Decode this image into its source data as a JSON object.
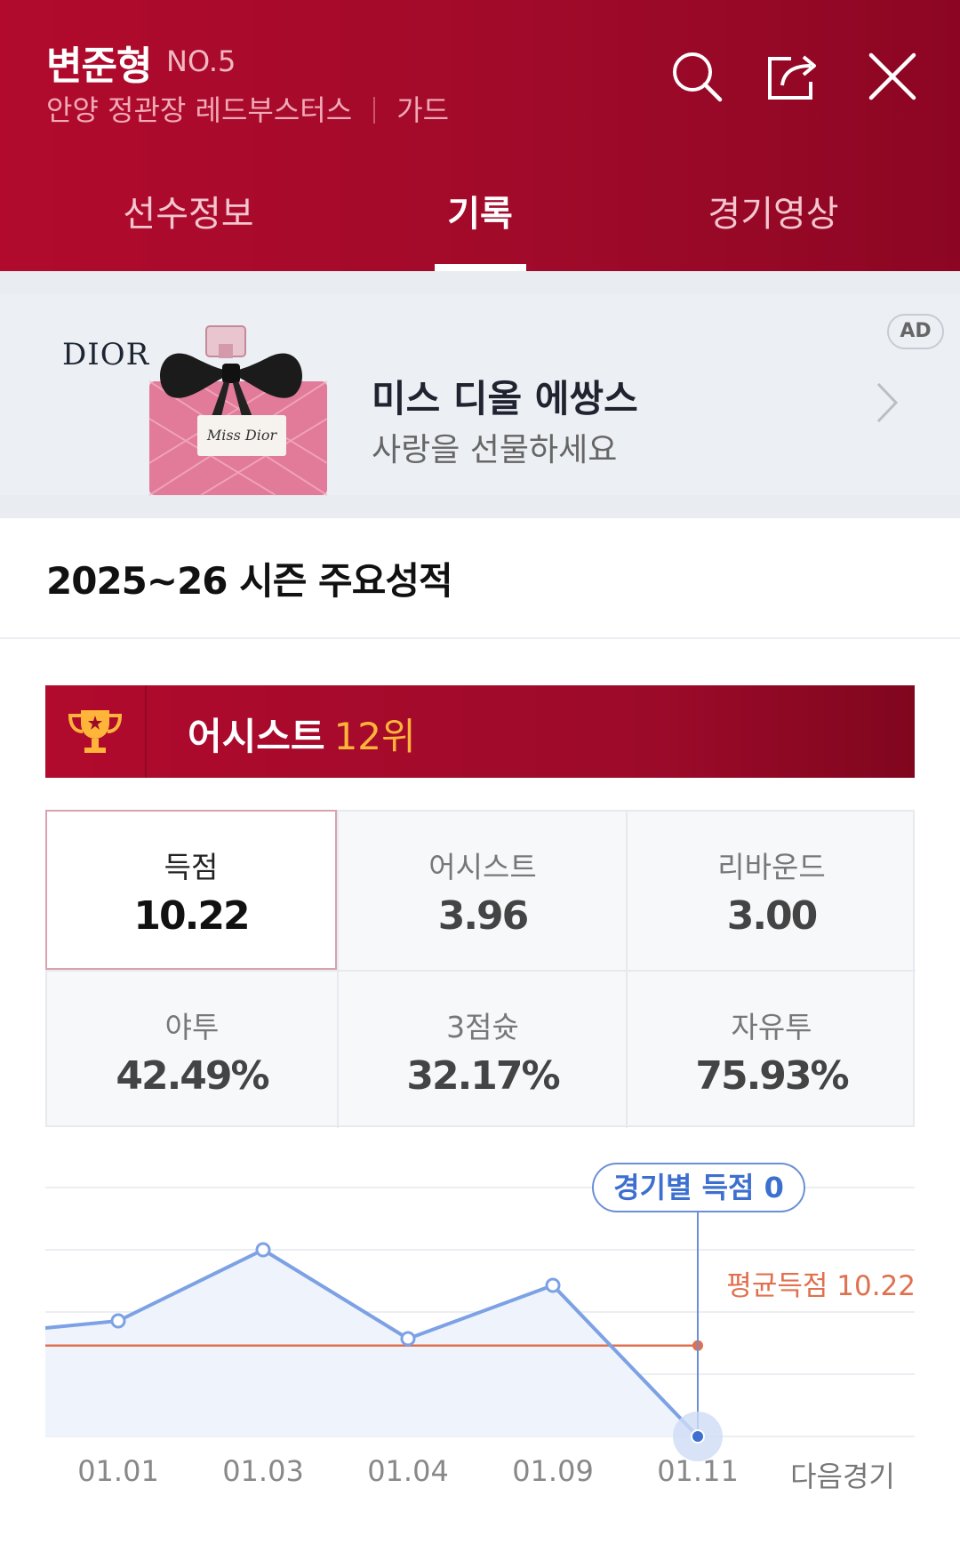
{
  "header": {
    "player_name": "변준형",
    "player_no": "NO.5",
    "team": "안양 정관장 레드부스터스",
    "position": "가드",
    "colors": {
      "primary": "#b10a2d",
      "accent": "#ffb43a"
    },
    "icons": [
      "search-icon",
      "share-icon",
      "close-icon"
    ]
  },
  "tabs": [
    {
      "label": "선수정보",
      "active": false
    },
    {
      "label": "기록",
      "active": true
    },
    {
      "label": "경기영상",
      "active": false
    }
  ],
  "ad": {
    "brand": "DIOR",
    "title": "미스 디올 에쌍스",
    "subtitle": "사랑을 선물하세요",
    "badge": "AD",
    "bottle_text": "Miss Dior"
  },
  "section": {
    "title": "2025~26 시즌 주요성적"
  },
  "rank": {
    "label": "어시스트",
    "value": "12위"
  },
  "stats": [
    {
      "label": "득점",
      "value": "10.22",
      "selected": true
    },
    {
      "label": "어시스트",
      "value": "3.96"
    },
    {
      "label": "리바운드",
      "value": "3.00"
    },
    {
      "label": "야투",
      "value": "42.49%"
    },
    {
      "label": "3점슛",
      "value": "32.17%"
    },
    {
      "label": "자유투",
      "value": "75.93%"
    }
  ],
  "chart_data": {
    "type": "line",
    "categories": [
      "01.01",
      "01.03",
      "01.04",
      "01.09",
      "01.11",
      "다음경기"
    ],
    "series": [
      {
        "values": [
          13,
          21,
          11,
          17,
          0
        ]
      }
    ],
    "average": {
      "label": "평균득점",
      "value": 10.22
    },
    "tooltip": {
      "label": "경기별 득점",
      "value": "0"
    },
    "ylim": [
      0,
      28
    ],
    "grid": true,
    "colors": {
      "line": "#7ca1e4",
      "fill": "#eef3fc",
      "average": "#e0704e"
    }
  }
}
